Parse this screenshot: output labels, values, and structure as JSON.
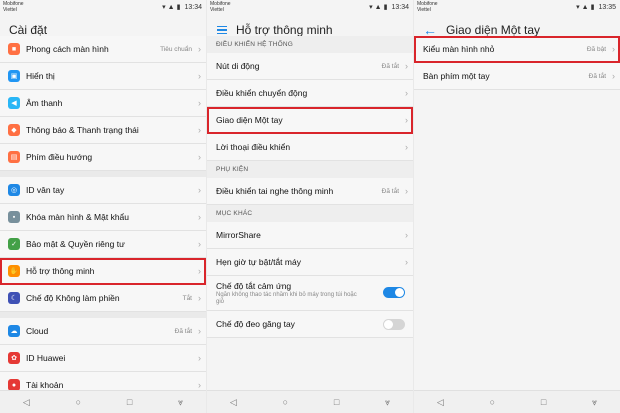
{
  "status": {
    "carrier": "Mobifone",
    "carrier2": "Viettel",
    "times": [
      "13:34",
      "13:34",
      "13:35"
    ]
  },
  "panel1": {
    "title": "Cài đặt",
    "items": [
      {
        "label": "Phong cách màn hình",
        "value": "Tiêu chuẩn",
        "icon": "home-screen-icon",
        "color": "#ff7043"
      },
      {
        "label": "Hiển thị",
        "value": "",
        "icon": "display-icon",
        "color": "#2196f3"
      },
      {
        "label": "Âm thanh",
        "value": "",
        "icon": "sound-icon",
        "color": "#29b6f6"
      },
      {
        "label": "Thông báo & Thanh trạng thái",
        "value": "",
        "icon": "notification-icon",
        "color": "#ff7043"
      },
      {
        "label": "Phím điều hướng",
        "value": "",
        "icon": "navigation-key-icon",
        "color": "#ff7043"
      },
      {
        "label": "ID vân tay",
        "value": "",
        "icon": "fingerprint-icon",
        "color": "#1e88e5"
      },
      {
        "label": "Khóa màn hình & Mật khẩu",
        "value": "",
        "icon": "lock-icon",
        "color": "#78909c"
      },
      {
        "label": "Bảo mật & Quyền riêng tư",
        "value": "",
        "icon": "shield-icon",
        "color": "#43a047"
      },
      {
        "label": "Hỗ trợ thông minh",
        "value": "",
        "icon": "hand-icon",
        "color": "#ff8f00"
      },
      {
        "label": "Chế độ Không làm phiền",
        "value": "Tắt",
        "icon": "moon-icon",
        "color": "#3f51b5"
      },
      {
        "label": "Cloud",
        "value": "Đã tắt",
        "icon": "cloud-icon",
        "color": "#1e88e5"
      },
      {
        "label": "ID Huawei",
        "value": "",
        "icon": "huawei-icon",
        "color": "#e53935"
      },
      {
        "label": "Tài khoản",
        "value": "",
        "icon": "account-icon",
        "color": "#e53935"
      }
    ]
  },
  "panel2": {
    "title": "Hỗ trợ thông minh",
    "section1": "ĐIỀU KHIỂN HỆ THỐNG",
    "items1": [
      {
        "label": "Nút di động",
        "value": "Đã tắt"
      },
      {
        "label": "Điều khiển chuyển động",
        "value": ""
      },
      {
        "label": "Giao diện Một tay",
        "value": ""
      },
      {
        "label": "Lời thoại điều khiển",
        "value": ""
      }
    ],
    "section2": "PHỤ KIỆN",
    "items2": [
      {
        "label": "Điều khiển tai nghe thông minh",
        "value": "Đã tắt"
      }
    ],
    "section3": "MỤC KHÁC",
    "items3": [
      {
        "label": "MirrorShare",
        "value": ""
      },
      {
        "label": "Hẹn giờ tự bật/tắt máy",
        "value": ""
      }
    ],
    "pocket": {
      "label": "Chế độ tắt cảm ứng",
      "sub": "Ngăn không thao tác nhầm khi bỏ máy trong túi hoặc giỏ",
      "on": true
    },
    "glove": {
      "label": "Chế độ đeo găng tay",
      "on": false
    }
  },
  "panel3": {
    "title": "Giao diện Một tay",
    "items": [
      {
        "label": "Kiểu màn hình nhỏ",
        "value": "Đã bật"
      },
      {
        "label": "Bàn phím một tay",
        "value": "Đã tắt"
      }
    ]
  },
  "nav": {
    "back": "◁",
    "home": "○",
    "recent": "□",
    "down": "⩔"
  }
}
